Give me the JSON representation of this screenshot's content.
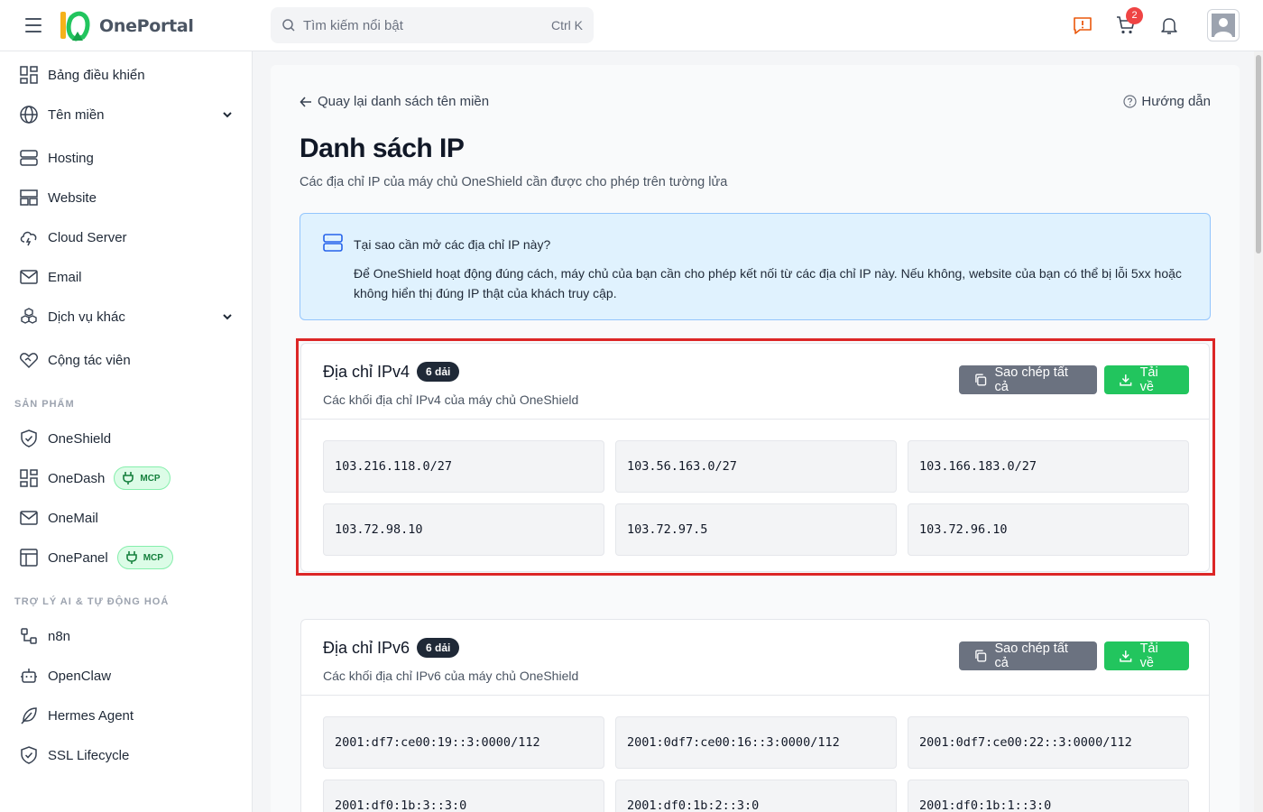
{
  "header": {
    "brand": "OnePortal",
    "search_placeholder": "Tìm kiếm nổi bật",
    "search_shortcut": "Ctrl K",
    "cart_count": "2"
  },
  "sidebar": {
    "items": [
      {
        "label": "Bảng điều khiển"
      },
      {
        "label": "Tên miền"
      },
      {
        "label": "Hosting"
      },
      {
        "label": "Website"
      },
      {
        "label": "Cloud Server"
      },
      {
        "label": "Email"
      },
      {
        "label": "Dịch vụ khác"
      },
      {
        "label": "Cộng tác viên"
      }
    ],
    "section_products": "SẢN PHẨM",
    "products": [
      {
        "label": "OneShield"
      },
      {
        "label": "OneDash",
        "badge": "MCP"
      },
      {
        "label": "OneMail"
      },
      {
        "label": "OnePanel",
        "badge": "MCP"
      }
    ],
    "section_ai": "TRỢ LÝ AI & TỰ ĐỘNG HOÁ",
    "ai": [
      {
        "label": "n8n"
      },
      {
        "label": "OpenClaw"
      },
      {
        "label": "Hermes Agent"
      },
      {
        "label": "SSL Lifecycle"
      }
    ]
  },
  "main": {
    "back_label": "Quay lại danh sách tên miền",
    "guide_label": "Hướng dẫn",
    "title": "Danh sách IP",
    "subtitle": "Các địa chỉ IP của máy chủ OneShield cần được cho phép trên tường lửa",
    "info": {
      "question": "Tại sao cần mở các địa chỉ IP này?",
      "text": "Để OneShield hoạt động đúng cách, máy chủ của bạn cần cho phép kết nối từ các địa chỉ IP này. Nếu không, website của bạn có thể bị lỗi 5xx hoặc không hiển thị đúng IP thật của khách truy cập."
    },
    "ipv4": {
      "title": "Địa chỉ IPv4",
      "count": "6 dải",
      "desc": "Các khối địa chỉ IPv4 của máy chủ OneShield",
      "copy_label": "Sao chép tất cả",
      "download_label": "Tải về",
      "ranges": [
        "103.216.118.0/27",
        "103.56.163.0/27",
        "103.166.183.0/27",
        "103.72.98.10",
        "103.72.97.5",
        "103.72.96.10"
      ]
    },
    "ipv6": {
      "title": "Địa chỉ IPv6",
      "count": "6 dải",
      "desc": "Các khối địa chỉ IPv6 của máy chủ OneShield",
      "copy_label": "Sao chép tất cả",
      "download_label": "Tải về",
      "ranges": [
        "2001:df7:ce00:19::3:0000/112",
        "2001:0df7:ce00:16::3:0000/112",
        "2001:0df7:ce00:22::3:0000/112",
        "2001:df0:1b:3::3:0",
        "2001:df0:1b:2::3:0",
        "2001:df0:1b:1::3:0"
      ]
    }
  },
  "colors": {
    "accent_green": "#22c55e",
    "button_gray": "#6b7280",
    "highlight_red": "#dc2626",
    "info_bg": "#e0f2fe"
  }
}
